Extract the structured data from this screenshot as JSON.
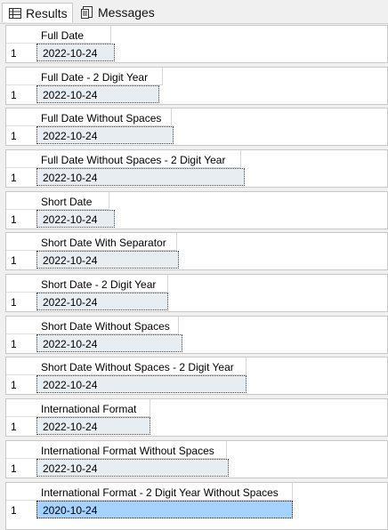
{
  "tabs": {
    "results_label": "Results",
    "messages_label": "Messages"
  },
  "grids": [
    {
      "header": "Full Date",
      "row": "1",
      "value": "2022-10-24"
    },
    {
      "header": "Full Date - 2 Digit Year",
      "row": "1",
      "value": "2022-10-24"
    },
    {
      "header": "Full Date Without Spaces",
      "row": "1",
      "value": "2022-10-24"
    },
    {
      "header": "Full Date Without Spaces - 2 Digit Year",
      "row": "1",
      "value": "2022-10-24"
    },
    {
      "header": "Short Date",
      "row": "1",
      "value": "2022-10-24"
    },
    {
      "header": "Short Date With Separator",
      "row": "1",
      "value": "2022-10-24"
    },
    {
      "header": "Short Date - 2 Digit Year",
      "row": "1",
      "value": "2022-10-24"
    },
    {
      "header": "Short Date Without Spaces",
      "row": "1",
      "value": "2022-10-24"
    },
    {
      "header": "Short Date Without Spaces - 2 Digit Year",
      "row": "1",
      "value": "2022-10-24"
    },
    {
      "header": "International Format",
      "row": "1",
      "value": "2022-10-24"
    },
    {
      "header": "International Format Without Spaces",
      "row": "1",
      "value": "2022-10-24"
    },
    {
      "header": "International Format - 2 Digit Year Without Spaces",
      "row": "1",
      "value": "2020-10-24"
    }
  ],
  "selected_grid": "International Format - 2 Digit Year Without Spaces",
  "colors": {
    "cell_bg": "#e8edf2",
    "selected_cell_bg": "#a6d2ff"
  }
}
